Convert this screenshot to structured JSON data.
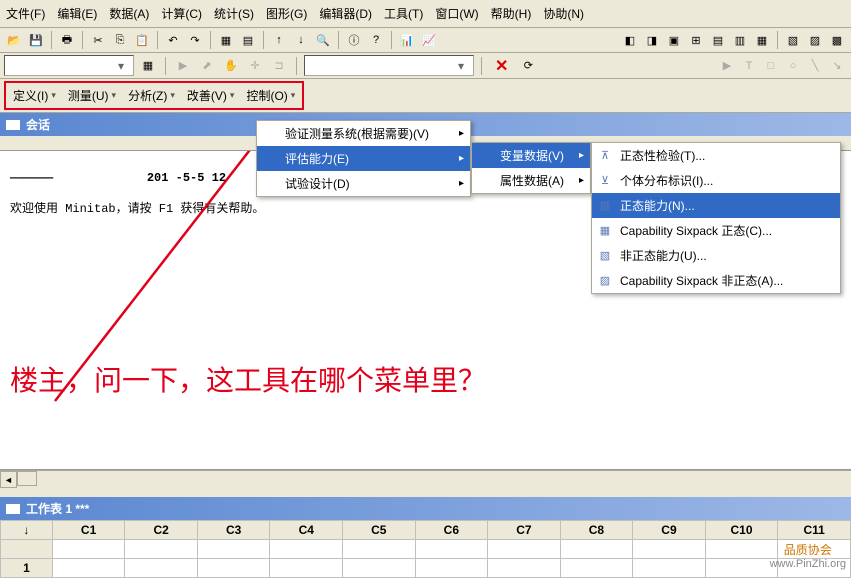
{
  "menubar": [
    "文件(F)",
    "编辑(E)",
    "数据(A)",
    "计算(C)",
    "统计(S)",
    "图形(G)",
    "编辑器(D)",
    "工具(T)",
    "窗口(W)",
    "帮助(H)",
    "协助(N)"
  ],
  "sigma_toolbar": [
    "定义(I)",
    "测量(U)",
    "分析(Z)",
    "改善(V)",
    "控制(O)"
  ],
  "session": {
    "title": "会话",
    "date_prefix": "—————— ",
    "date": "201 -5-5 12",
    "welcome": "欢迎使用 Minitab，请按 F1 获得有关帮助。"
  },
  "annotation": "楼主，问一下，这工具在哪个菜单里？",
  "popup1": [
    {
      "label": "验证测量系统(根据需要)(V)",
      "arrow": true
    },
    {
      "label": "评估能力(E)",
      "arrow": true,
      "highlight": true
    },
    {
      "label": "试验设计(D)",
      "arrow": true
    }
  ],
  "popup2": [
    {
      "label": "变量数据(V)",
      "arrow": true,
      "highlight": true
    },
    {
      "label": "属性数据(A)",
      "arrow": true
    }
  ],
  "popup3": [
    {
      "icon": "⊼",
      "label": "正态性检验(T)..."
    },
    {
      "icon": "⊻",
      "label": "个体分布标识(I)..."
    },
    {
      "icon": "▥",
      "label": "正态能力(N)...",
      "highlight": true
    },
    {
      "icon": "▦",
      "label": "Capability Sixpack 正态(C)..."
    },
    {
      "icon": "▧",
      "label": "非正态能力(U)..."
    },
    {
      "icon": "▨",
      "label": "Capability Sixpack 非正态(A)..."
    }
  ],
  "worksheet": {
    "title": "工作表 1 ***",
    "headers": [
      "↓",
      "C1",
      "C2",
      "C3",
      "C4",
      "C5",
      "C6",
      "C7",
      "C8",
      "C9",
      "C10",
      "C11"
    ],
    "emptyrow": [
      "",
      "",
      "",
      "",
      "",
      "",
      "",
      "",
      "",
      "",
      "",
      ""
    ],
    "rows": [
      [
        "1",
        "",
        "",
        "",
        "",
        "",
        "",
        "",
        "",
        "",
        "",
        ""
      ]
    ]
  },
  "watermark": {
    "cn": "品质协会",
    "en": "www.PinZhi.org"
  }
}
